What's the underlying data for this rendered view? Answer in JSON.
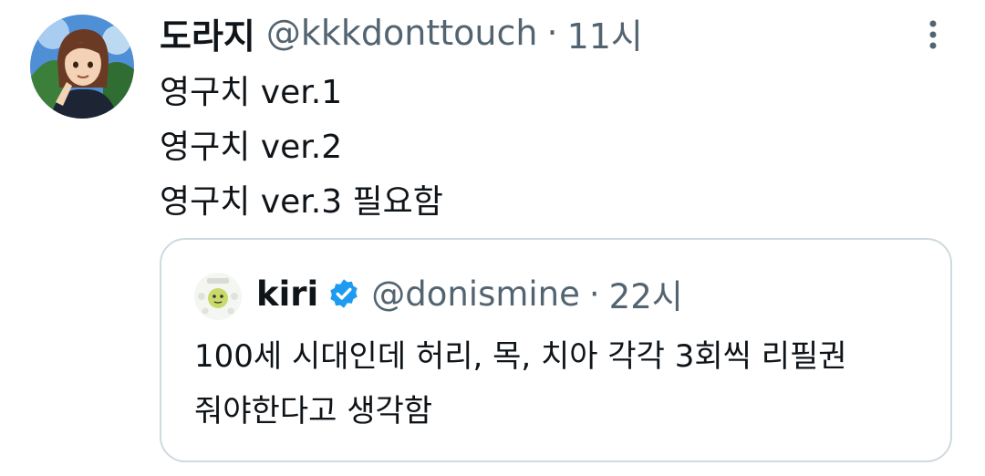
{
  "tweet": {
    "display_name": "도라지",
    "handle": "@kkkdonttouch",
    "separator": "·",
    "time": "11시",
    "lines": [
      "영구치 ver.1",
      "영구치 ver.2",
      "영구치 ver.3 필요함"
    ]
  },
  "quoted_tweet": {
    "display_name": "kiri",
    "handle": "@donismine",
    "separator": "·",
    "time": "22시",
    "lines": [
      "100세 시대인데 허리, 목, 치아 각각 3회씩 리필권",
      "줘야한다고 생각함"
    ]
  },
  "icons": {
    "more": "more-vertical-icon",
    "verified": "verified-badge-icon"
  },
  "colors": {
    "text": "#0f1419",
    "secondary": "#536471",
    "border": "#cfd9de",
    "verified": "#1d9bf0"
  }
}
